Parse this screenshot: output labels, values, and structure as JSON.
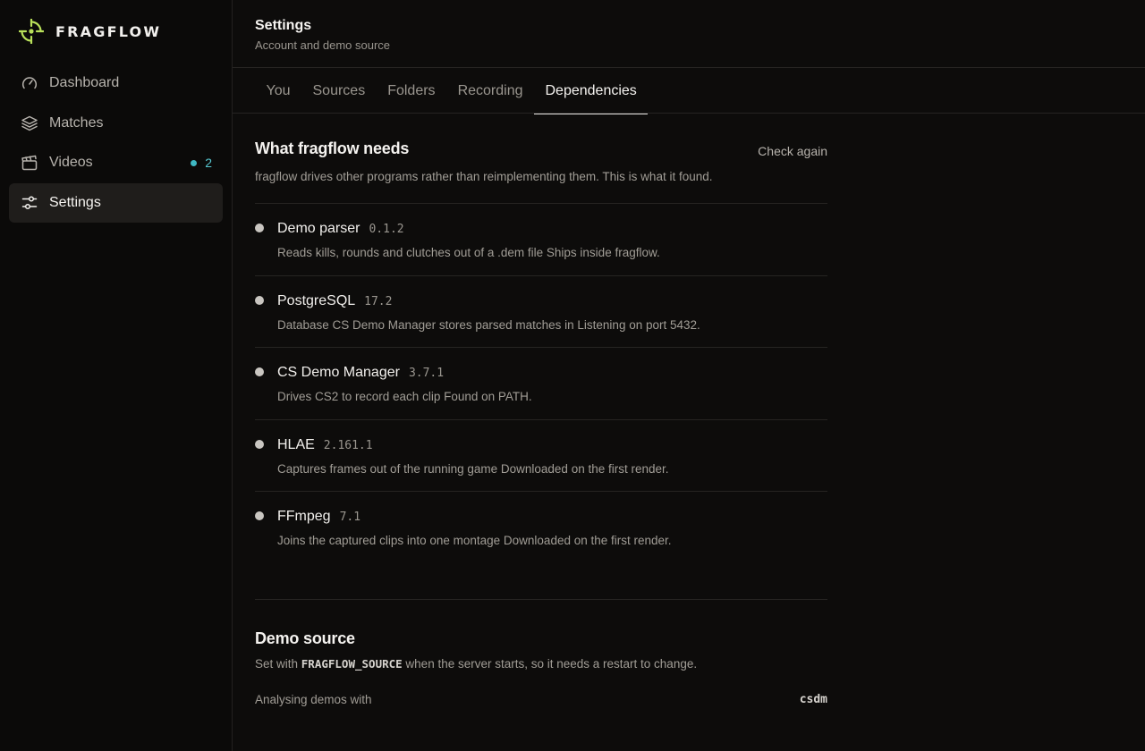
{
  "app": {
    "name": "FRAGFLOW",
    "logo_icon": "crosshair-icon",
    "accent_color": "#b9e05a"
  },
  "sidebar": {
    "items": [
      {
        "label": "Dashboard",
        "icon": "gauge-icon",
        "active": false
      },
      {
        "label": "Matches",
        "icon": "layers-icon",
        "active": false
      },
      {
        "label": "Videos",
        "icon": "clapperboard-icon",
        "active": false,
        "badge": "2",
        "badge_color": "#3fb8c3"
      },
      {
        "label": "Settings",
        "icon": "sliders-icon",
        "active": true
      }
    ]
  },
  "header": {
    "title": "Settings",
    "subtitle": "Account and demo source"
  },
  "tabs": [
    {
      "label": "You",
      "active": false
    },
    {
      "label": "Sources",
      "active": false
    },
    {
      "label": "Folders",
      "active": false
    },
    {
      "label": "Recording",
      "active": false
    },
    {
      "label": "Dependencies",
      "active": true
    }
  ],
  "dependencies": {
    "title": "What fragflow needs",
    "check_again": "Check again",
    "description": "fragflow drives other programs rather than reimplementing them. This is what it found.",
    "items": [
      {
        "name": "Demo parser",
        "version": "0.1.2",
        "description": "Reads kills, rounds and clutches out of a .dem file Ships inside fragflow."
      },
      {
        "name": "PostgreSQL",
        "version": "17.2",
        "description": "Database CS Demo Manager stores parsed matches in Listening on port 5432."
      },
      {
        "name": "CS Demo Manager",
        "version": "3.7.1",
        "description": "Drives CS2 to record each clip Found on PATH."
      },
      {
        "name": "HLAE",
        "version": "2.161.1",
        "description": "Captures frames out of the running game Downloaded on the first render."
      },
      {
        "name": "FFmpeg",
        "version": "7.1",
        "description": "Joins the captured clips into one montage Downloaded on the first render."
      }
    ]
  },
  "demo_source": {
    "title": "Demo source",
    "desc_prefix": "Set with ",
    "env_var": "FRAGFLOW_SOURCE",
    "desc_suffix": " when the server starts, so it needs a restart to change.",
    "label": "Analysing demos with",
    "value": "csdm"
  }
}
